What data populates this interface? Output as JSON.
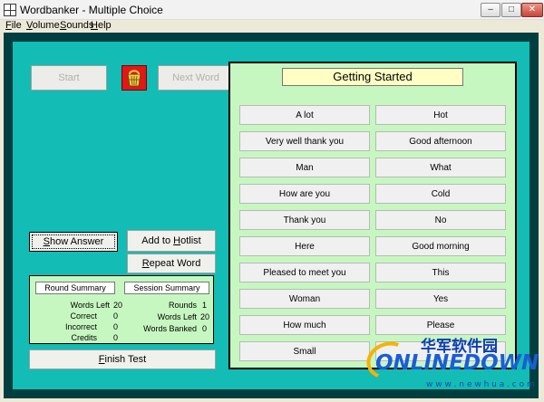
{
  "window": {
    "title": "Wordbanker - Multiple Choice"
  },
  "menu": [
    {
      "label": "File",
      "key": "F",
      "rest": "ile"
    },
    {
      "label": "Volume",
      "key": "V",
      "rest": "olume"
    },
    {
      "label": "Sounds",
      "key": "S",
      "rest": "ounds"
    },
    {
      "label": "Help",
      "key": "H",
      "rest": "elp"
    }
  ],
  "controls": {
    "start": "Start",
    "next_word": "Next Word",
    "show_answer_key": "S",
    "show_answer_rest": "how Answer",
    "add_hotlist_pre": "Add to ",
    "add_hotlist_key": "H",
    "add_hotlist_rest": "otlist",
    "repeat_key": "R",
    "repeat_rest": "epeat Word",
    "finish_key": "F",
    "finish_rest": "inish Test"
  },
  "round_summary": {
    "title": "Round Summary",
    "rows": [
      {
        "label": "Words Left",
        "value": "20"
      },
      {
        "label": "Correct",
        "value": "0"
      },
      {
        "label": "Incorrect",
        "value": "0"
      },
      {
        "label": "Credits",
        "value": "0"
      }
    ]
  },
  "session_summary": {
    "title": "Session Summary",
    "rows": [
      {
        "label": "Rounds",
        "value": "1"
      },
      {
        "label": "Words Left",
        "value": "20"
      },
      {
        "label": "Words Banked",
        "value": "0"
      }
    ]
  },
  "lesson": {
    "title": "Getting Started",
    "left_answers": [
      "A lot",
      "Very well thank you",
      "Man",
      "How are you",
      "Thank you",
      "Here",
      "Pleased to meet you",
      "Woman",
      "How much",
      "Small"
    ],
    "right_answers": [
      "Hot",
      "Good afternoon",
      "What",
      "Cold",
      "No",
      "Good morning",
      "This",
      "Yes",
      "Please",
      ""
    ]
  },
  "watermark": {
    "cn": "华军软件园",
    "main": "ONLINEDOWN",
    "url": "w w w . n e w h u a . c o m"
  },
  "colors": {
    "background": "#13bcb5",
    "panel": "#c7f7c1",
    "title_box": "#ffffc4",
    "basket": "#e01818"
  }
}
